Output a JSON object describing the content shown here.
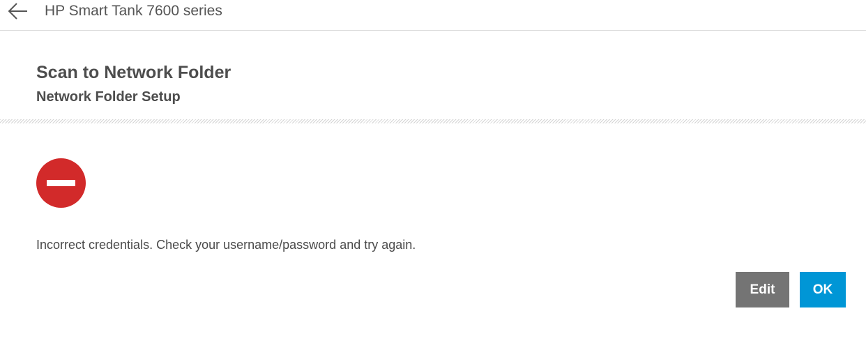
{
  "header": {
    "back_icon": "arrow-left-icon",
    "title": "HP Smart Tank 7600 series"
  },
  "page": {
    "title": "Scan to Network Folder",
    "subtitle": "Network Folder Setup"
  },
  "error": {
    "icon": "no-entry-icon",
    "icon_color": "#d22a2a",
    "message": "Incorrect credentials. Check your username/password and try again."
  },
  "actions": {
    "edit_label": "Edit",
    "edit_color": "#747474",
    "ok_label": "OK",
    "ok_color": "#0096d6"
  }
}
